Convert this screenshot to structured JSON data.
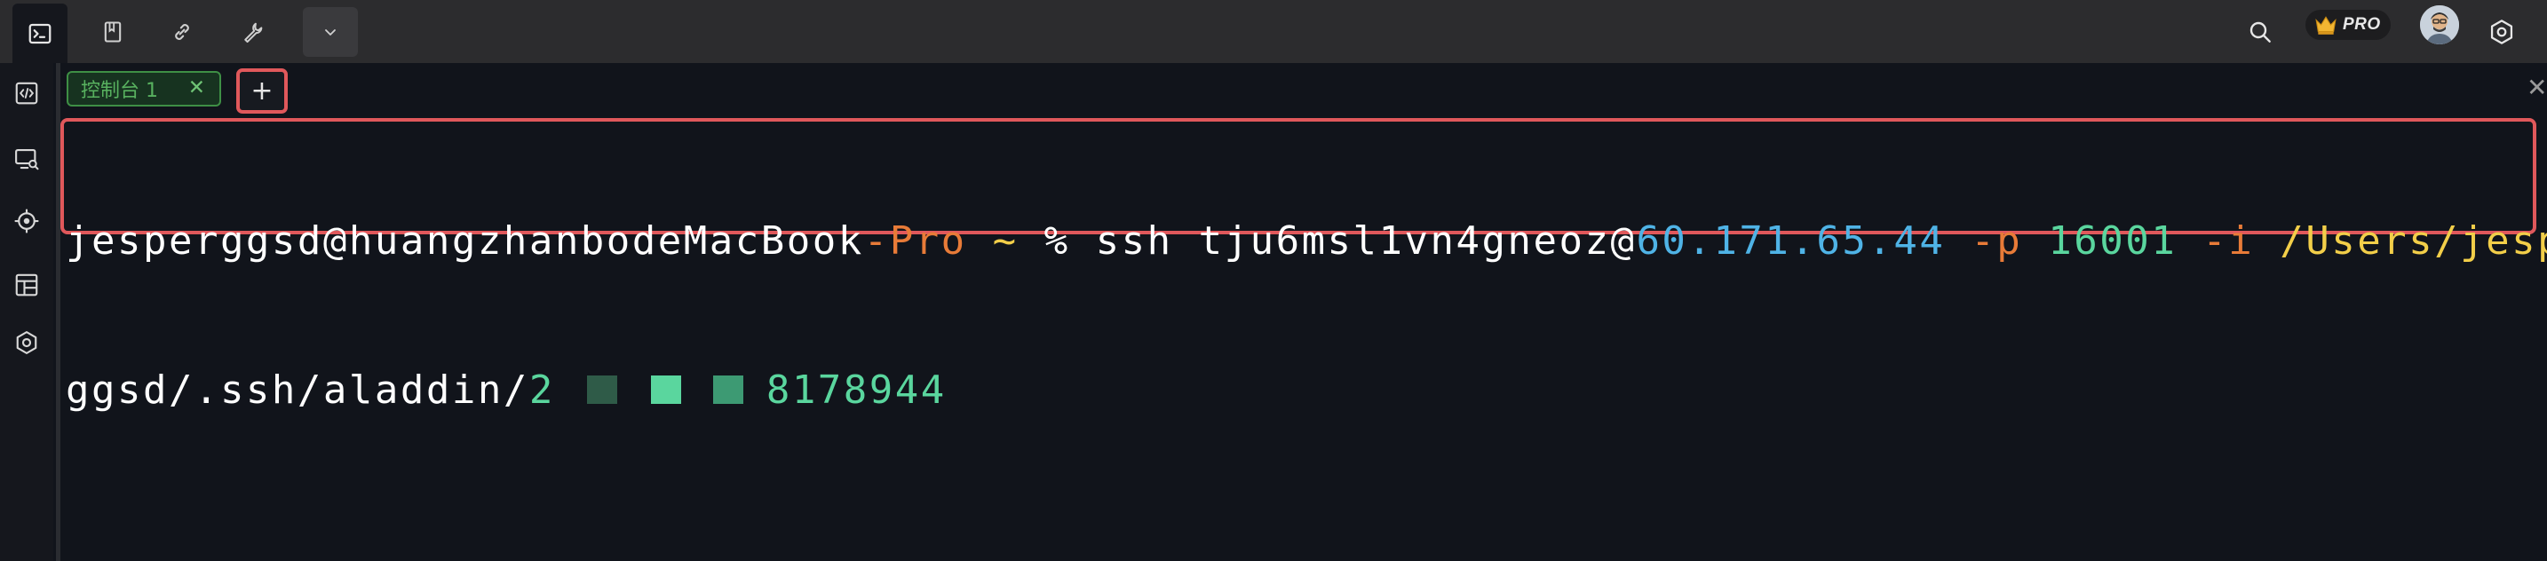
{
  "top_tabs": {
    "console_icon": "terminal-icon",
    "book_icon": "book-icon",
    "link_icon": "link-icon",
    "wrench_icon": "wrench-icon",
    "dropdown_icon": "chevron-down-icon"
  },
  "header_right": {
    "search_icon": "search-icon",
    "pro_label": "PRO",
    "settings_icon": "settings-icon"
  },
  "sidebar": {
    "items": [
      {
        "icon": "code-icon"
      },
      {
        "icon": "remote-desktop-icon"
      },
      {
        "icon": "crosshair-icon"
      },
      {
        "icon": "layout-icon"
      },
      {
        "icon": "hexagon-icon"
      }
    ]
  },
  "terminal_tabs": [
    {
      "label": "控制台  1",
      "close": "✕"
    }
  ],
  "add_tab_label": "+",
  "pane_close": "✕",
  "terminal": {
    "line1": {
      "user_host": "jesperggsd@huangzhanbodeMacBook",
      "host_suffix": "-Pro",
      "tilde": " ~",
      "prompt": " % ",
      "cmd": "ssh tju6msl1vn4gneoz@",
      "ip": "60.171.65.44",
      "flag_p": " -p ",
      "port": "16001",
      "flag_i": " -i ",
      "path_start": "/Users/jesper"
    },
    "line2": {
      "path_rest": "ggsd/.ssh/aladdin/",
      "file_visible_start": "2",
      "file_visible_end": "8178944"
    }
  },
  "colors": {
    "accent_red": "#e0585b",
    "tab_green": "#58b15f",
    "host_orange": "#e87b38",
    "tilde_yellow": "#f2ce49",
    "ip_cyan": "#4fb3e6",
    "port_green": "#5ad69e"
  }
}
